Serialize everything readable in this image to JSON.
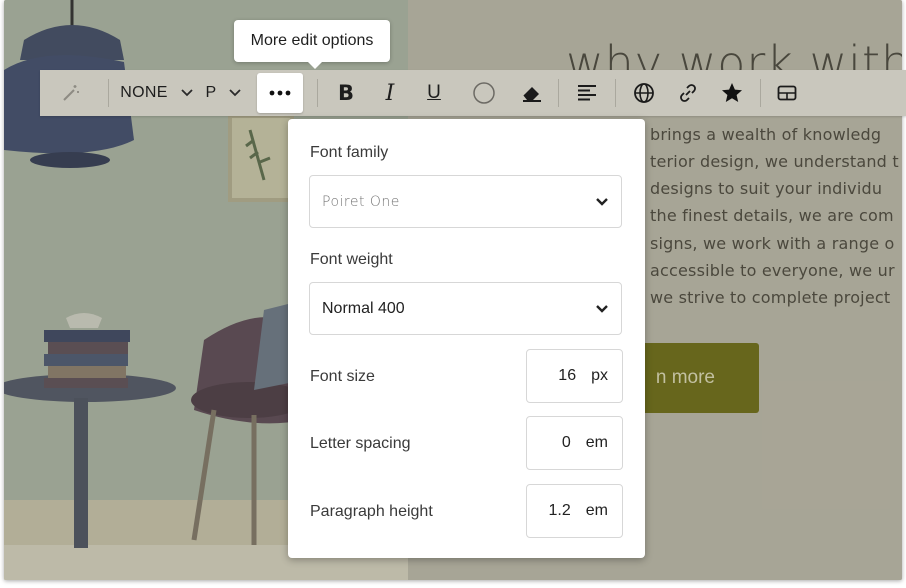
{
  "tooltip": {
    "text": "More edit options"
  },
  "toolbar": {
    "style_label": "NONE",
    "paragraph_label": "P",
    "more_label": "•••",
    "bold_label": "B",
    "italic_label": "I",
    "underline_label": "U"
  },
  "panel": {
    "font_family": {
      "label": "Font family",
      "value": "Poiret One"
    },
    "font_weight": {
      "label": "Font weight",
      "value": "Normal 400"
    },
    "font_size": {
      "label": "Font size",
      "value": "16",
      "unit": "px"
    },
    "letter_spacing": {
      "label": "Letter spacing",
      "value": "0",
      "unit": "em"
    },
    "paragraph_height": {
      "label": "Paragraph height",
      "value": "1.2",
      "unit": "em"
    }
  },
  "page": {
    "heading": "why work with u",
    "paragraph_lines": [
      "brings a wealth of knowledg",
      "terior design, we understand t",
      "designs to suit your individu",
      "the finest details, we are com",
      "signs, we work with a range o",
      "accessible to everyone, we ur",
      "we strive to complete project"
    ],
    "button_label": "n more"
  },
  "colors": {
    "toolbar_bg": "#c9c7bd",
    "button_bg": "#6b6a12",
    "panel_bg": "#ffffff"
  }
}
